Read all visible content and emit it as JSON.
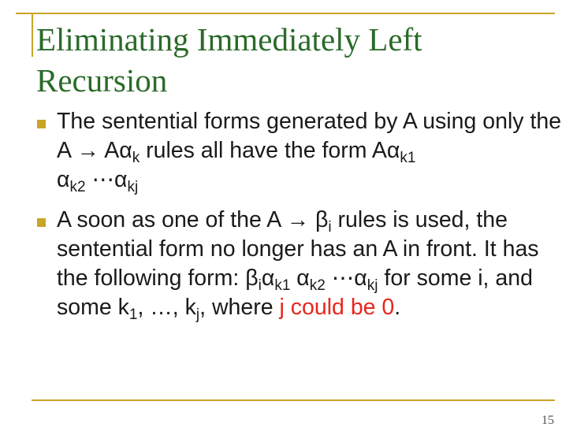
{
  "title": {
    "line1": "Eliminating Immediately Left",
    "line2": "Recursion"
  },
  "bullets": [
    {
      "t1": "The sentential forms generated by A using only the A → Aα",
      "s1": "k",
      "t2": " rules all have the form Aα",
      "s2": "k1",
      "t3": " α",
      "s3": "k2",
      "t4": " ⋯α",
      "s4": "kj"
    },
    {
      "t1": "A soon as one of the A → β",
      "s1": "i",
      "t2": " rules is used, the sentential form no longer has an A in front. It has the following form: β",
      "s2": "i",
      "t3": "α",
      "s3": "k1",
      "t4": " α",
      "s4": "k2",
      "t5": " ⋯α",
      "s5": "kj",
      "t6": " for some i, and some k",
      "s6": "1",
      "t7": ", …, k",
      "s7": "j",
      "t8": ", where ",
      "highlight": "j could be 0",
      "t9": "."
    }
  ],
  "page_number": "15",
  "colors": {
    "title": "#2a6a2a",
    "accent": "#c9a527",
    "body_text": "#1a1a1a",
    "highlight": "#e8261d"
  }
}
